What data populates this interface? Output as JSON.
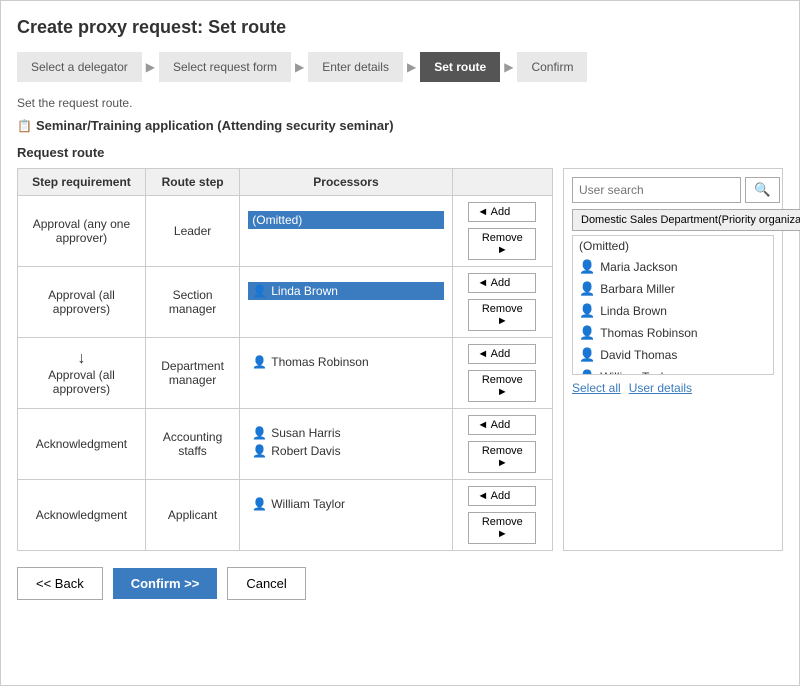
{
  "page": {
    "title": "Create proxy request: Set route",
    "subtitle": "Set the request route.",
    "form_label_icon": "📋",
    "form_label": "Seminar/Training application (Attending security seminar)"
  },
  "wizard": {
    "steps": [
      {
        "id": "select-delegator",
        "label": "Select a delegator",
        "active": false
      },
      {
        "id": "select-form",
        "label": "Select request form",
        "active": false
      },
      {
        "id": "enter-details",
        "label": "Enter details",
        "active": false
      },
      {
        "id": "set-route",
        "label": "Set route",
        "active": true
      },
      {
        "id": "confirm",
        "label": "Confirm",
        "active": false
      }
    ]
  },
  "route_table": {
    "headers": {
      "step_req": "Step requirement",
      "route_step": "Route step",
      "processors": "Processors"
    },
    "rows": [
      {
        "id": "row-leader",
        "step_req": "Approval (any one approver)",
        "route_step": "Leader",
        "processors": [
          {
            "name": "(Omitted)",
            "selected": true,
            "icon": false
          }
        ],
        "add_label": "◄ Add",
        "remove_label": "Remove ►",
        "has_arrow": false
      },
      {
        "id": "row-section",
        "step_req": "Approval (all approvers)",
        "route_step": "Section manager",
        "processors": [
          {
            "name": "Linda Brown",
            "selected": true,
            "icon": true
          }
        ],
        "add_label": "◄ Add",
        "remove_label": "Remove ►",
        "has_arrow": false
      },
      {
        "id": "row-department",
        "step_req": "Approval (all approvers)",
        "route_step": "Department manager",
        "processors": [
          {
            "name": "Thomas Robinson",
            "selected": false,
            "icon": true
          }
        ],
        "add_label": "◄ Add",
        "remove_label": "Remove ►",
        "has_arrow": true
      },
      {
        "id": "row-accounting",
        "step_req": "Acknowledgment",
        "route_step": "Accounting staffs",
        "processors": [
          {
            "name": "Susan Harris",
            "selected": false,
            "icon": true
          },
          {
            "name": "Robert Davis",
            "selected": false,
            "icon": true
          }
        ],
        "add_label": "◄ Add",
        "remove_label": "Remove ►",
        "has_arrow": false
      },
      {
        "id": "row-applicant",
        "step_req": "Acknowledgment",
        "route_step": "Applicant",
        "processors": [
          {
            "name": "William Taylor",
            "selected": false,
            "icon": true
          }
        ],
        "add_label": "◄ Add",
        "remove_label": "Remove ►",
        "has_arrow": false
      }
    ]
  },
  "right_panel": {
    "search_placeholder": "User search",
    "search_btn_icon": "🔍",
    "dept_options": [
      "Domestic Sales Department(Priority organization)"
    ],
    "dept_selected": "Domestic Sales Department(Priority organization)",
    "copy_btn": "⧉",
    "users": [
      {
        "name": "(Omitted)",
        "icon": false
      },
      {
        "name": "Maria Jackson",
        "icon": true
      },
      {
        "name": "Barbara Miller",
        "icon": true
      },
      {
        "name": "Linda Brown",
        "icon": true
      },
      {
        "name": "Thomas Robinson",
        "icon": true
      },
      {
        "name": "David Thomas",
        "icon": true
      },
      {
        "name": "William Taylor",
        "icon": true
      }
    ],
    "select_all_label": "Select all",
    "user_details_label": "User details"
  },
  "bottom_buttons": {
    "back_label": "<< Back",
    "confirm_label": "Confirm >>",
    "cancel_label": "Cancel"
  }
}
